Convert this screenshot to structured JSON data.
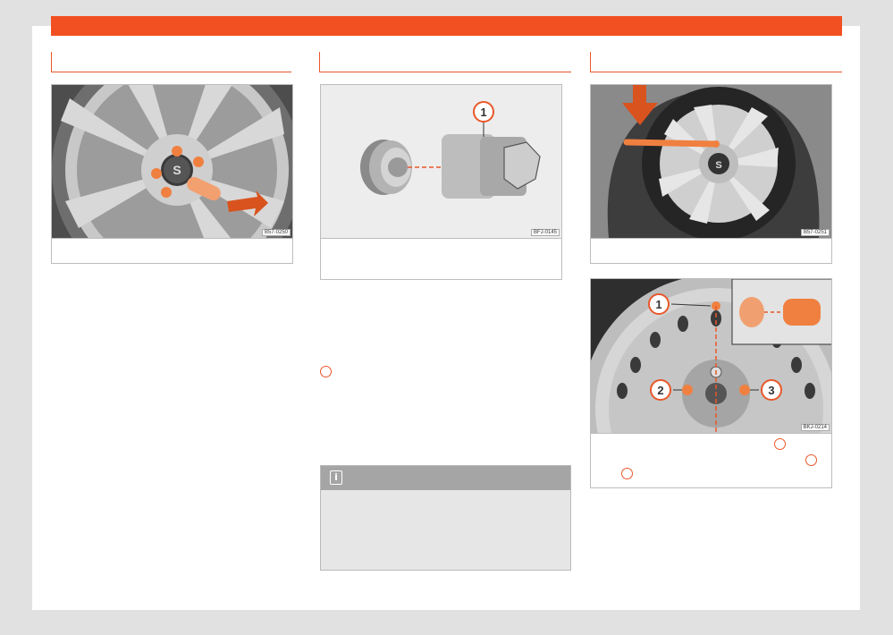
{
  "figures": {
    "fig1": {
      "code": "B57-0250"
    },
    "fig2": {
      "code": "BFJ-0145",
      "callout": "1"
    },
    "fig3": {
      "code": "B57-0251"
    },
    "fig4": {
      "code": "BKJ-0214",
      "callouts": [
        "1",
        "2",
        "3"
      ]
    }
  },
  "note": {
    "icon": "info-icon",
    "glyph": "i"
  },
  "colors": {
    "accent": "#f25022",
    "frame": "#bdbdbd",
    "note_bg": "#e6e6e6",
    "note_head": "#a5a5a5"
  }
}
